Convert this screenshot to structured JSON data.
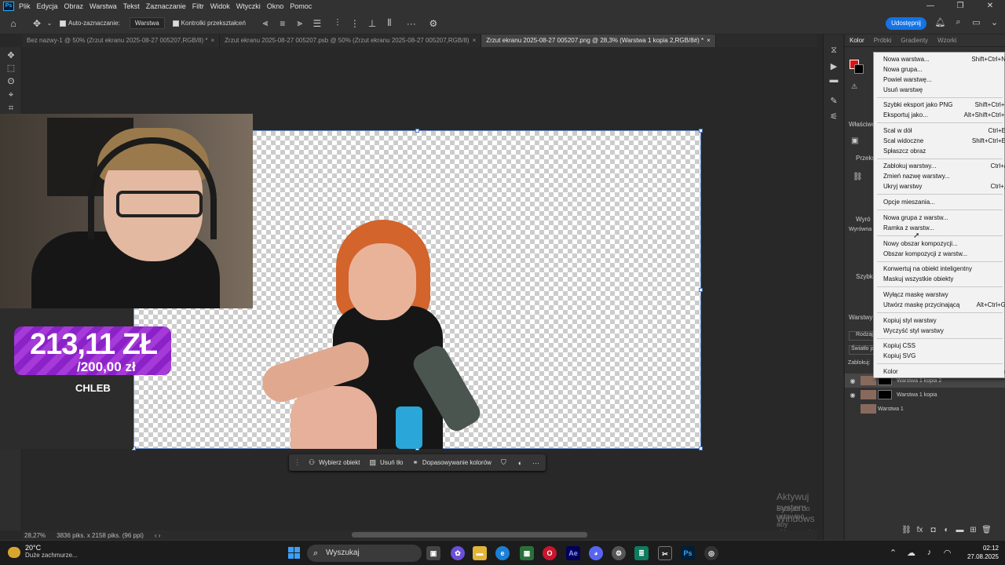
{
  "menubar": {
    "app_icon": "Ps",
    "items": [
      "Plik",
      "Edycja",
      "Obraz",
      "Warstwa",
      "Tekst",
      "Zaznaczanie",
      "Filtr",
      "Widok",
      "Wtyczki",
      "Okno",
      "Pomoc"
    ],
    "window_controls": [
      "—",
      "❐",
      "✕"
    ]
  },
  "options": {
    "auto_select_label": "Auto-zaznaczanie:",
    "auto_select_value": "Warstwa",
    "transform_controls_label": "Kontrolki przekształceń",
    "share_label": "Udostępnij"
  },
  "tabs": [
    {
      "label": "Bez nazwy-1 @ 50% (Zrzut ekranu 2025-08-27 005207,RGB/8) *",
      "close": "×"
    },
    {
      "label": "Zrzut ekranu 2025-08-27 005207.psb @ 50% (Zrzut ekranu 2025-08-27 005207,RGB/8)",
      "close": "×"
    },
    {
      "label": "Zrzut ekranu 2025-08-27 005207.png @ 28,3% (Warstwa 1 kopia 2,RGB/8#) *",
      "close": "×"
    }
  ],
  "donation": {
    "amount": "213,11 ZŁ",
    "goal": "/200,00 zł",
    "name": "CHLEB"
  },
  "contextual_taskbar": {
    "select_subject": "Wybierz obiekt",
    "remove_bg": "Usuń tło",
    "color_match": "Dopasowywanie kolorów"
  },
  "watermark": {
    "line1": "Aktywuj system Windows",
    "line2": "Przejdź do ustawień, aby aktywować system Windows."
  },
  "status": {
    "zoom": "28,27%",
    "dimensions": "3836 piks. x 2158 piks. (96 ppi)",
    "nav": "‹ ›"
  },
  "right_panel": {
    "tabs": [
      "Kolor",
      "Próbki",
      "Gradienty",
      "Wzorki"
    ],
    "properties_label": "Właściwo",
    "transform_label": "Przeks",
    "align_label": "Wyró",
    "align_sub": "Wyrówna",
    "quick_label": "Szybk",
    "layers_label": "Warstwy",
    "search_placeholder": "Rodzaj",
    "blend_mode": "Światło ja",
    "lock_label": "Zablokuj:",
    "layers": [
      {
        "name": "Warstwa 1 kopia 2",
        "visible": true,
        "selected": true
      },
      {
        "name": "Warstwa 1 kopia",
        "visible": true,
        "selected": false
      },
      {
        "name": "Warstwa 1",
        "visible": false,
        "selected": false
      }
    ]
  },
  "context_menu": {
    "items": [
      {
        "label": "Nowa warstwa...",
        "shortcut": "Shift+Ctrl+N"
      },
      {
        "label": "Nowa grupa...",
        "shortcut": ""
      },
      {
        "label": "Powiel warstwę...",
        "shortcut": ""
      },
      {
        "label": "Usuń warstwę",
        "shortcut": ""
      },
      {
        "label": "Szybki eksport jako PNG",
        "shortcut": "Shift+Ctrl+'"
      },
      {
        "label": "Eksportuj jako...",
        "shortcut": "Alt+Shift+Ctrl+'"
      },
      {
        "label": "Scal w dół",
        "shortcut": "Ctrl+E"
      },
      {
        "label": "Scal widoczne",
        "shortcut": "Shift+Ctrl+E"
      },
      {
        "label": "Spłaszcz obraz",
        "shortcut": ""
      },
      {
        "label": "Zablokuj warstwy...",
        "shortcut": "Ctrl+/"
      },
      {
        "label": "Zmień nazwę warstwy...",
        "shortcut": ""
      },
      {
        "label": "Ukryj warstwy",
        "shortcut": "Ctrl+,"
      },
      {
        "label": "Opcje mieszania...",
        "shortcut": ""
      },
      {
        "label": "Nowa grupa z warstw...",
        "shortcut": ""
      },
      {
        "label": "Ramka z warstw...",
        "shortcut": ""
      },
      {
        "label": "Nowy obszar kompozycji...",
        "shortcut": ""
      },
      {
        "label": "Obszar kompozycji z warstw...",
        "shortcut": ""
      },
      {
        "label": "Konwertuj na obiekt inteligentny",
        "shortcut": ""
      },
      {
        "label": "Maskuj wszystkie obiekty",
        "shortcut": ""
      },
      {
        "label": "Wyłącz maskę warstwy",
        "shortcut": ""
      },
      {
        "label": "Utwórz maskę przycinającą",
        "shortcut": "Alt+Ctrl+G"
      },
      {
        "label": "Kopiuj styl warstwy",
        "shortcut": ""
      },
      {
        "label": "Wyczyść styl warstwy",
        "shortcut": ""
      },
      {
        "label": "Kopiuj CSS",
        "shortcut": ""
      },
      {
        "label": "Kopiuj SVG",
        "shortcut": ""
      },
      {
        "label": "Kolor",
        "shortcut": "›"
      }
    ]
  },
  "taskbar": {
    "temp": "20°C",
    "weather": "Duże zachmurze...",
    "search_placeholder": "Wyszukaj",
    "time": "02:12",
    "date": "27.08.2025"
  },
  "colors": {
    "accent": "#1473e6",
    "foreground_swatch": "#e01010",
    "background_swatch": "#000000",
    "donation_purple": "#9a2ed0"
  }
}
